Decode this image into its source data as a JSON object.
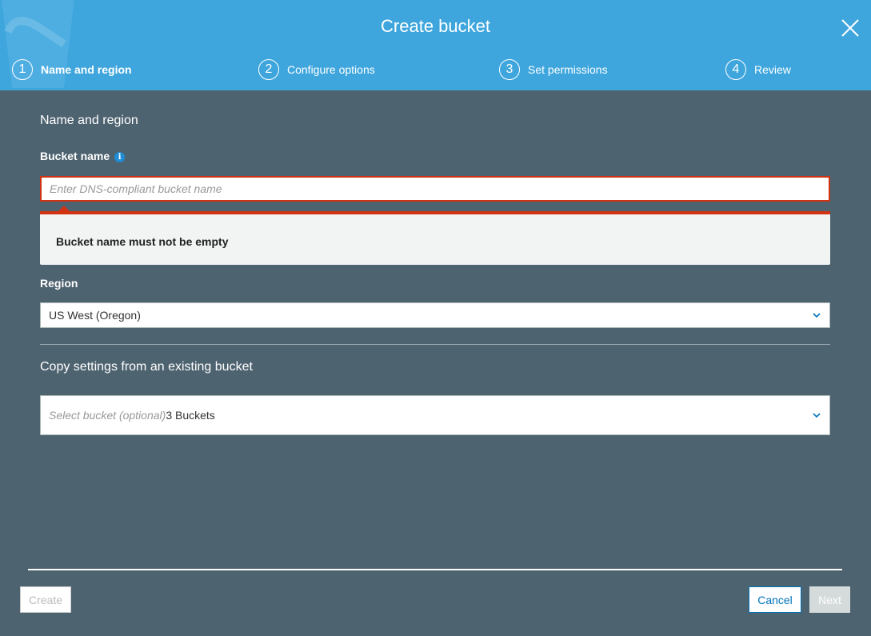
{
  "header": {
    "title": "Create bucket",
    "steps": [
      {
        "number": "1",
        "label": "Name and region",
        "active": true
      },
      {
        "number": "2",
        "label": "Configure options",
        "active": false
      },
      {
        "number": "3",
        "label": "Set permissions",
        "active": false
      },
      {
        "number": "4",
        "label": "Review",
        "active": false
      }
    ]
  },
  "name_region": {
    "section_title": "Name and region",
    "bucket_name_label": "Bucket name",
    "bucket_name_placeholder": "Enter DNS-compliant bucket name",
    "bucket_name_value": "",
    "error_message": "Bucket name must not be empty",
    "region_label": "Region",
    "region_value": "US West (Oregon)"
  },
  "copy_settings": {
    "section_title": "Copy settings from an existing bucket",
    "select_placeholder": "Select bucket (optional)",
    "bucket_count": "3 Buckets"
  },
  "footer": {
    "create_label": "Create",
    "cancel_label": "Cancel",
    "next_label": "Next"
  },
  "colors": {
    "header_bg": "#3ea6dd",
    "body_bg": "#4e6370",
    "error": "#d13212",
    "link": "#0073bb"
  }
}
